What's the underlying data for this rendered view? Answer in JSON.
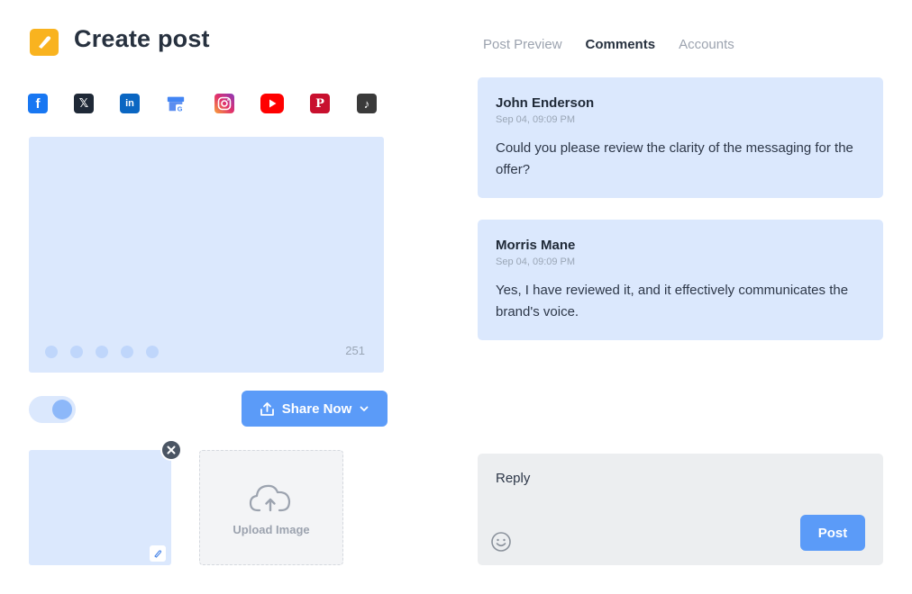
{
  "header": {
    "title": "Create post"
  },
  "socials": [
    {
      "name": "facebook",
      "glyph": "f",
      "color": "#1877f2"
    },
    {
      "name": "x",
      "glyph": "𝕏",
      "color": "#1f2937"
    },
    {
      "name": "linkedin",
      "glyph": "in",
      "color": "#0a66c2"
    },
    {
      "name": "google-business",
      "glyph": "G",
      "color": "#4285f4"
    },
    {
      "name": "instagram",
      "glyph": "◎",
      "color": "#e1306c"
    },
    {
      "name": "youtube",
      "glyph": "▶",
      "color": "#ff0000"
    },
    {
      "name": "pinterest",
      "glyph": "P",
      "color": "#c8102e"
    },
    {
      "name": "tiktok",
      "glyph": "♪",
      "color": "#3a3a3a"
    }
  ],
  "preview": {
    "char_count": "251"
  },
  "actions": {
    "share_label": "Share Now"
  },
  "media": {
    "upload_label": "Upload Image"
  },
  "tabs": [
    {
      "label": "Post Preview",
      "active": false
    },
    {
      "label": "Comments",
      "active": true
    },
    {
      "label": "Accounts",
      "active": false
    }
  ],
  "comments": [
    {
      "author": "John Enderson",
      "time": "Sep 04, 09:09 PM",
      "text": "Could you please review the clarity of the messaging for the offer?"
    },
    {
      "author": "Morris Mane",
      "time": "Sep 04, 09:09 PM",
      "text": "Yes, I have reviewed it, and it effectively communicates the brand's voice."
    }
  ],
  "reply": {
    "placeholder": "Reply",
    "post_label": "Post"
  },
  "colors": {
    "accent": "#5b9bf8",
    "surface": "#dbe8fd",
    "logo": "#f9b31f"
  }
}
